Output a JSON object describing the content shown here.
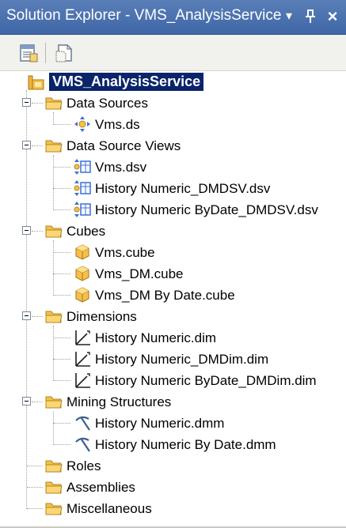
{
  "window": {
    "title": "Solution Explorer - VMS_AnalysisService",
    "dropdown_glyph": "▾",
    "pin_glyph": "⊥",
    "close_glyph": "×"
  },
  "toolbar": {
    "buttons": [
      "properties-icon",
      "show-all-files-icon"
    ]
  },
  "tree": {
    "root": {
      "label": "VMS_AnalysisService",
      "icon": "project-icon"
    },
    "folders": [
      {
        "label": "Data Sources",
        "items": [
          {
            "label": "Vms.ds",
            "icon": "data-source-icon"
          }
        ]
      },
      {
        "label": "Data Source Views",
        "items": [
          {
            "label": "Vms.dsv",
            "icon": "data-source-view-icon"
          },
          {
            "label": "History Numeric_DMDSV.dsv",
            "icon": "data-source-view-icon"
          },
          {
            "label": "History Numeric ByDate_DMDSV.dsv",
            "icon": "data-source-view-icon"
          }
        ]
      },
      {
        "label": "Cubes",
        "items": [
          {
            "label": "Vms.cube",
            "icon": "cube-icon"
          },
          {
            "label": "Vms_DM.cube",
            "icon": "cube-icon"
          },
          {
            "label": "Vms_DM By Date.cube",
            "icon": "cube-icon"
          }
        ]
      },
      {
        "label": "Dimensions",
        "items": [
          {
            "label": "History Numeric.dim",
            "icon": "dimension-icon"
          },
          {
            "label": "History Numeric_DMDim.dim",
            "icon": "dimension-icon"
          },
          {
            "label": "History Numeric ByDate_DMDim.dim",
            "icon": "dimension-icon"
          }
        ]
      },
      {
        "label": "Mining Structures",
        "items": [
          {
            "label": "History Numeric.dmm",
            "icon": "mining-structure-icon"
          },
          {
            "label": "History Numeric By Date.dmm",
            "icon": "mining-structure-icon"
          }
        ]
      },
      {
        "label": "Roles",
        "items": []
      },
      {
        "label": "Assemblies",
        "items": []
      },
      {
        "label": "Miscellaneous",
        "items": []
      }
    ]
  },
  "colors": {
    "titlebar": "#3f67a6",
    "selection": "#0a246a",
    "folder": "#f5c04a"
  }
}
